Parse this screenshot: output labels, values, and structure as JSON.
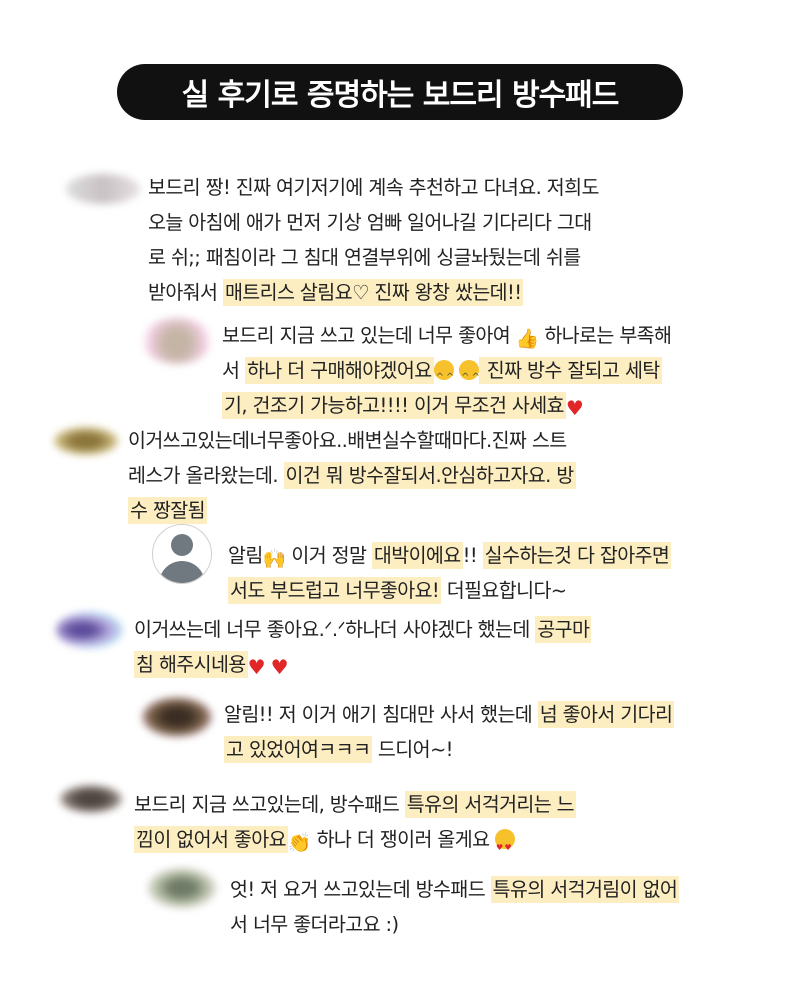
{
  "title": "실 후기로 증명하는 보드리 방수패드",
  "comments": [
    {
      "lines": [
        [
          {
            "t": "보드리 짱! 진짜 여기저기에 계속 추천하고 다녀요. 저희도"
          }
        ],
        [
          {
            "t": "오늘 아침에 애가 먼저 기상 엄빠 일어나길 기다리다 그대"
          }
        ],
        [
          {
            "t": "로 쉬;; 패침이라 그 침대 연결부위에 싱글놔뒀는데 쉬를"
          }
        ],
        [
          {
            "t": "받아줘서 "
          },
          {
            "t": "매트리스 살림요♡ 진짜 왕창 쌌는데!!",
            "hl": true
          }
        ]
      ]
    },
    {
      "lines": [
        [
          {
            "t": "보드리 지금 쓰고 있는데 너무 좋아여 "
          },
          {
            "icon": "thumbs-up"
          },
          {
            "t": " 하나로는 부족해"
          }
        ],
        [
          {
            "t": "서 "
          },
          {
            "t": "하나 더 구매해야겠어요",
            "hl": true
          },
          {
            "icon": "grin"
          },
          {
            "t": " "
          },
          {
            "icon": "grin"
          },
          {
            "t": " 진짜 방수 잘되고 세탁",
            "hl": true
          }
        ],
        [
          {
            "t": "기, 건조기 가능하고!!!! 이거 무조건 사세효",
            "hl": true
          },
          {
            "icon": "heart"
          }
        ]
      ]
    },
    {
      "lines": [
        [
          {
            "t": "이거쓰고있는데너무좋아요..배변실수할때마다.진짜 스트"
          }
        ],
        [
          {
            "t": "레스가 올라왔는데. "
          },
          {
            "t": "이건 뭐 방수잘되서.안심하고자요. 방",
            "hl": true
          }
        ],
        [
          {
            "t": "수 짱잘됨",
            "hl": true
          }
        ]
      ]
    },
    {
      "lines": [
        [
          {
            "t": "알림"
          },
          {
            "icon": "raised-hands"
          },
          {
            "t": " 이거 정말 "
          },
          {
            "t": "대박이에요",
            "hl": true
          },
          {
            "t": "!! "
          },
          {
            "t": "실수하는것 다 잡아주면",
            "hl": true
          }
        ],
        [
          {
            "t": "서도 부드럽고 너무좋아요!",
            "hl": true
          },
          {
            "t": " 더필요합니다~"
          }
        ]
      ]
    },
    {
      "lines": [
        [
          {
            "t": "이거쓰는데 너무 좋아요.ᐟ.ᐟ하나더 사야겠다 했는데 "
          },
          {
            "t": "공구마",
            "hl": true
          }
        ],
        [
          {
            "t": "침 해주시네용",
            "hl": true
          },
          {
            "icon": "heart"
          },
          {
            "t": " "
          },
          {
            "icon": "heart"
          }
        ]
      ]
    },
    {
      "lines": [
        [
          {
            "t": "알림!! 저 이거 애기 침대만 사서 했는데 "
          },
          {
            "t": "넘 좋아서 기다리",
            "hl": true
          }
        ],
        [
          {
            "t": "고 있었어여ㅋㅋㅋ",
            "hl": true
          },
          {
            "t": " 드디어~!"
          }
        ]
      ]
    },
    {
      "lines": [
        [
          {
            "t": "보드리 지금 쓰고있는데, 방수패드 "
          },
          {
            "t": "특유의 서걱거리는 느",
            "hl": true
          }
        ],
        [
          {
            "t": "낌이 없어서 좋아요",
            "hl": true
          },
          {
            "icon": "clap"
          },
          {
            "t": " 하나 더 쟁이러 올게요 "
          },
          {
            "icon": "heart-eyes"
          }
        ]
      ]
    },
    {
      "lines": [
        [
          {
            "t": "엇! 저 요거 쓰고있는데 방수패드 "
          },
          {
            "t": "특유의 서걱거림이 없어",
            "hl": true
          }
        ],
        [
          {
            "t": "서 너무 좋더라고요 :)"
          }
        ]
      ]
    }
  ],
  "avatar_colors": [
    "#c9c1c3",
    "#f0c8c8",
    "#9c8a5a",
    "#ffffff",
    "#9a8cc8",
    "#6e5a4a",
    "#6e6460",
    "#a9b29a"
  ]
}
